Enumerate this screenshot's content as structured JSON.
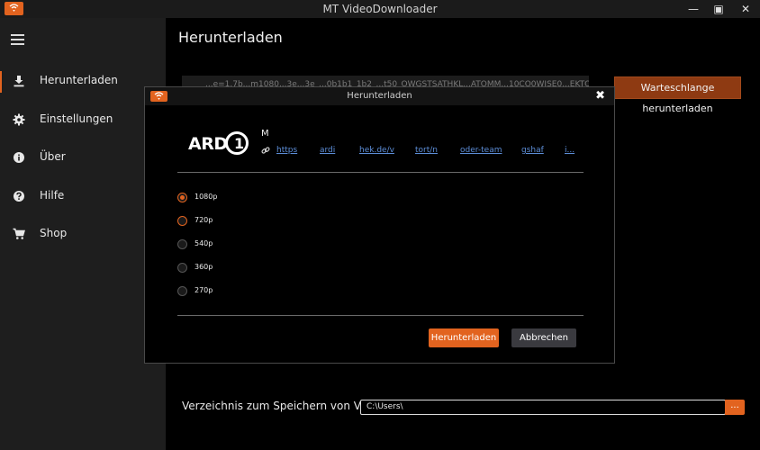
{
  "window": {
    "title": "MT VideoDownloader",
    "minimize": "—",
    "maximize": "▣",
    "close": "✕"
  },
  "sidebar": {
    "items": [
      {
        "label": "Herunterladen",
        "icon": "download-icon",
        "active": true
      },
      {
        "label": "Einstellungen",
        "icon": "gear-icon"
      },
      {
        "label": "Über",
        "icon": "info-icon"
      },
      {
        "label": "Hilfe",
        "icon": "help-icon"
      },
      {
        "label": "Shop",
        "icon": "cart-icon"
      }
    ]
  },
  "main": {
    "page_title": "Herunterladen",
    "url_value": "...e=1.7b...m1080...3e...3e_...0b1b1_1b2_...t50_OWGSTSATHKL...ATOMM...10CO0WISE0...EKTOFRMS",
    "queue_button": "Warteschlange herunterladen",
    "save_dir_label": "Verzeichnis zum Speichern von Videos",
    "save_dir_value": "C:\\Users\\",
    "browse_button": "..."
  },
  "dialog": {
    "title": "Herunterladen",
    "close": "✖",
    "logo_text": "ARD",
    "logo_number": "1",
    "video_title": "M",
    "link_fragments": [
      "https",
      "ardi",
      "hek.de/v",
      "tort/n",
      "oder-team",
      "gshaf",
      "i..."
    ],
    "resolutions": [
      {
        "label": "1080p",
        "selected": true
      },
      {
        "label": "720p",
        "hover": true
      },
      {
        "label": "540p"
      },
      {
        "label": "360p"
      },
      {
        "label": "270p"
      }
    ],
    "download_button": "Herunterladen",
    "cancel_button": "Abbrechen"
  },
  "colors": {
    "accent": "#e2631f",
    "queue_button": "#8e3a12",
    "link": "#5d8ed8",
    "sidebar_bg": "#1e1e1e"
  }
}
